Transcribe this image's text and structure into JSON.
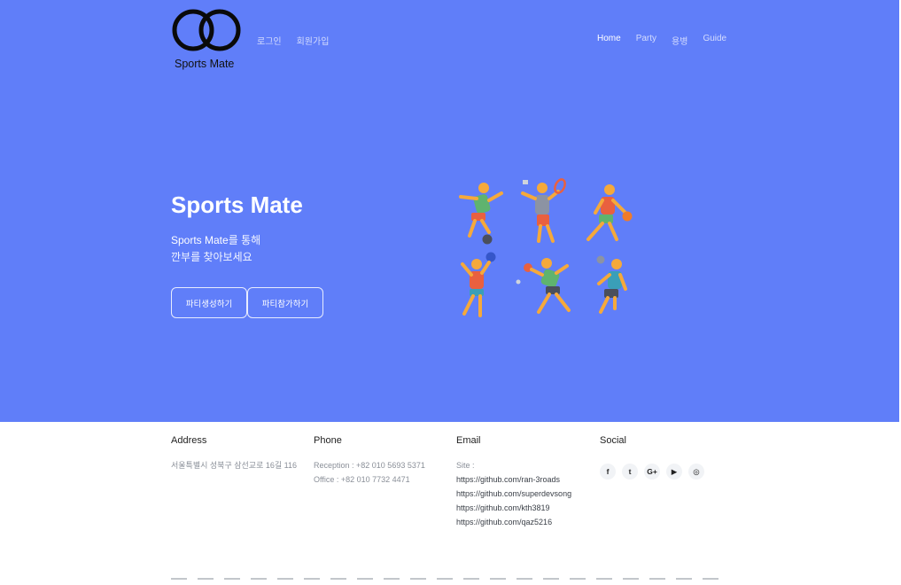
{
  "brand": {
    "logo_text": "Sports Mate"
  },
  "nav": {
    "login": "로그인",
    "signup": "회원가입",
    "home": "Home",
    "party": "Party",
    "lesson": "용병",
    "guide": "Guide"
  },
  "hero": {
    "title": "Sports Mate",
    "subtitle_brand": "Sports Mate",
    "subtitle_rest": "를 통해",
    "subtitle_line2": "깐부를 찾아보세요",
    "create_button": "파티생성하기",
    "join_button": "파티참가하기",
    "background_color": "#607ef9"
  },
  "footer": {
    "address": {
      "heading": "Address",
      "text": "서울특별시 성북구 삼선교로 16길 116"
    },
    "phone": {
      "heading": "Phone",
      "reception": "Reception : +82 010 5693 5371",
      "office": "Office : +82 010 7732 4471"
    },
    "email": {
      "heading": "Email",
      "site_label": "Site :",
      "links": [
        "https://github.com/ran-3roads",
        "https://github.com/superdevsong",
        "https://github.com/kth3819",
        "https://github.com/qaz5216"
      ]
    },
    "social": {
      "heading": "Social",
      "icons": [
        "facebook-icon",
        "twitter-icon",
        "google-plus-icon",
        "youtube-icon",
        "instagram-icon"
      ],
      "glyphs": [
        "f",
        "t",
        "G+",
        "▶",
        "◎"
      ]
    }
  }
}
